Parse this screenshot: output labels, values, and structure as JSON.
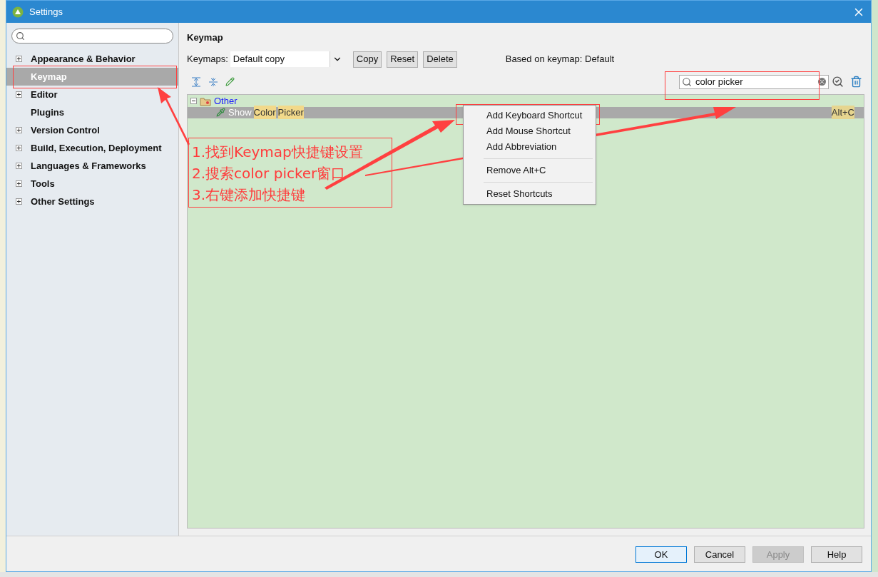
{
  "window": {
    "title": "Settings"
  },
  "sidebar": {
    "items": [
      {
        "label": "Appearance & Behavior",
        "expandable": true,
        "selected": false
      },
      {
        "label": "Keymap",
        "expandable": false,
        "selected": true
      },
      {
        "label": "Editor",
        "expandable": true,
        "selected": false
      },
      {
        "label": "Plugins",
        "expandable": false,
        "selected": false
      },
      {
        "label": "Version Control",
        "expandable": true,
        "selected": false
      },
      {
        "label": "Build, Execution, Deployment",
        "expandable": true,
        "selected": false
      },
      {
        "label": "Languages & Frameworks",
        "expandable": true,
        "selected": false
      },
      {
        "label": "Tools",
        "expandable": true,
        "selected": false
      },
      {
        "label": "Other Settings",
        "expandable": true,
        "selected": false
      }
    ]
  },
  "panel": {
    "title": "Keymap",
    "keymap_label": "Keymaps:",
    "keymap_value": "Default copy",
    "buttons": [
      "Copy",
      "Reset",
      "Delete"
    ],
    "based_on": "Based on keymap: Default",
    "search_value": "color picker",
    "tree": [
      {
        "label": "Other",
        "expanded": true,
        "children": [
          {
            "segments": [
              {
                "text": "Show",
                "match": false
              },
              {
                "text": "Color",
                "match": true
              },
              {
                "text": "Picker",
                "match": true
              }
            ],
            "shortcut": "Alt+C",
            "selected": true
          }
        ]
      }
    ]
  },
  "context_menu": [
    {
      "kind": "item",
      "label": "Add Keyboard Shortcut"
    },
    {
      "kind": "item",
      "label": "Add Mouse Shortcut"
    },
    {
      "kind": "item",
      "label": "Add Abbreviation"
    },
    {
      "kind": "separator"
    },
    {
      "kind": "item",
      "label": "Remove Alt+C"
    },
    {
      "kind": "separator"
    },
    {
      "kind": "item",
      "label": "Reset Shortcuts"
    }
  ],
  "footer_buttons": [
    {
      "label": "OK",
      "default": true,
      "disabled": false
    },
    {
      "label": "Cancel",
      "default": false,
      "disabled": false
    },
    {
      "label": "Apply",
      "default": false,
      "disabled": true
    },
    {
      "label": "Help",
      "default": false,
      "disabled": false
    }
  ],
  "annotation": {
    "lines": [
      "1.找到Keymap快捷键设置",
      "2.搜索color picker窗口",
      "3.右键添加快捷键"
    ]
  }
}
